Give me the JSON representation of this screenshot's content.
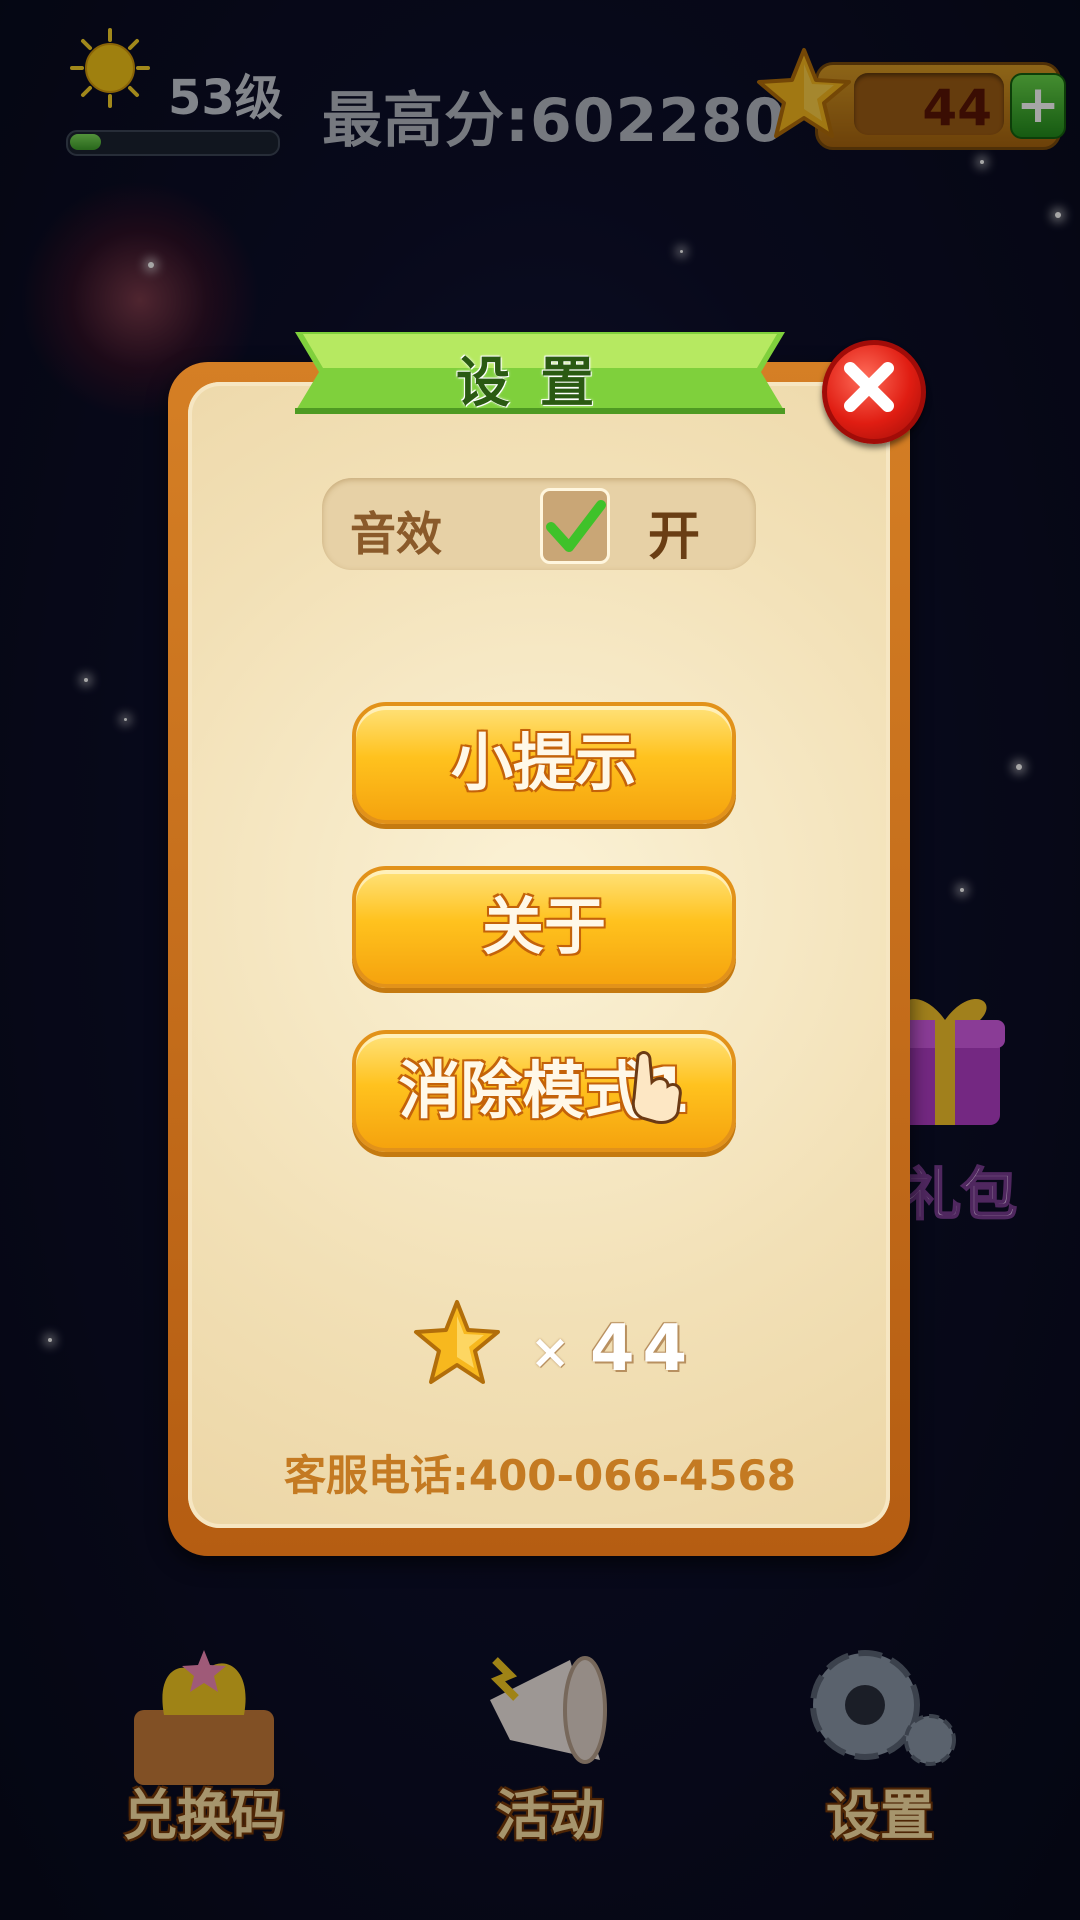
{
  "hud": {
    "level_text": "53级",
    "xp_progress": 0.15,
    "high_score_text": "最高分:602280",
    "coin_count": "44",
    "add_coins_symbol": "+"
  },
  "background": {
    "gift_label": "礼包"
  },
  "settings_dialog": {
    "title": "设置",
    "sound_label": "音效",
    "sound_state": "开",
    "sound_enabled": true,
    "buttons": [
      "小提示",
      "关于",
      "消除模式1"
    ],
    "star_multiplier": "×",
    "star_count": "44",
    "service_phone": "客服电话:400-066-4568"
  },
  "bottom_nav": {
    "redeem_label": "兑换码",
    "events_label": "活动",
    "settings_label": "设置"
  },
  "colors": {
    "panel_border": "#c86c1a",
    "panel_bg": "#f2e0b6",
    "ribbon_green": "#8ee04a",
    "button_gold": "#ffc21e",
    "close_red": "#e01d12"
  }
}
